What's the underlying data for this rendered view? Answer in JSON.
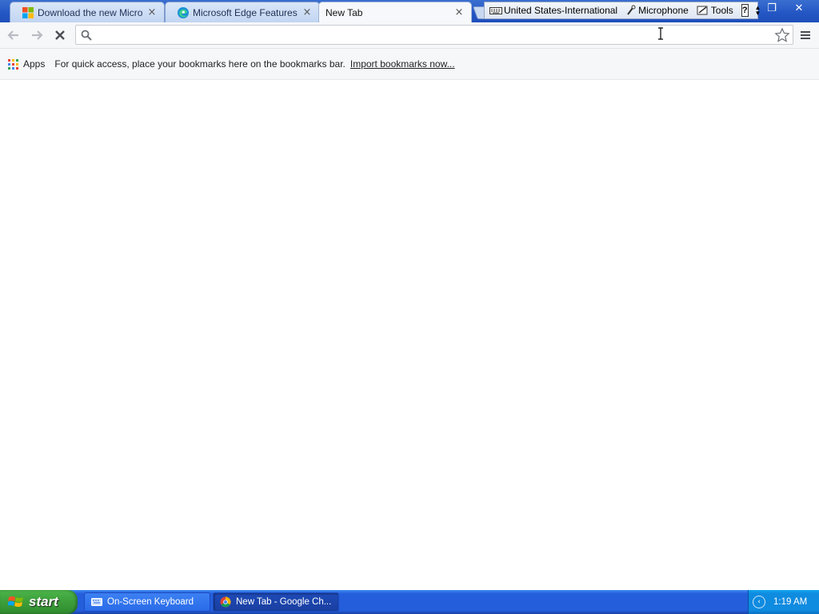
{
  "browser": {
    "tabs": [
      {
        "title": "Download the new Microsoft Edge",
        "close": "×",
        "icon": "microsoft-logo-icon",
        "active": false
      },
      {
        "title": "Microsoft Edge Features & Tips",
        "close": "×",
        "icon": "edge-logo-icon",
        "active": false
      },
      {
        "title": "New Tab",
        "close": "×",
        "icon": "",
        "active": true
      }
    ],
    "window_buttons": {
      "restore": "❐",
      "close": "✕"
    }
  },
  "language_bar": {
    "language": "United States-International",
    "microphone": "Microphone",
    "tools": "Tools",
    "help": "?"
  },
  "toolbar": {
    "back_icon": "back-arrow-icon",
    "forward_icon": "forward-arrow-icon",
    "stop_icon": "stop-icon",
    "address_value": "",
    "address_placeholder": ""
  },
  "bookmarks_bar": {
    "apps_label": "Apps",
    "message": "For quick access, place your bookmarks here on the bookmarks bar.",
    "import_link": "Import bookmarks now..."
  },
  "taskbar": {
    "start_label": "start",
    "tasks": [
      {
        "label": "On-Screen Keyboard",
        "active": false
      },
      {
        "label": "New Tab - Google Ch...",
        "active": true
      }
    ],
    "clock": "1:19 AM"
  },
  "colors": {
    "titlebar": "#2456c4",
    "taskbar": "#245edb",
    "start_green": "#3c9e3a",
    "tray": "#0f8be0"
  }
}
